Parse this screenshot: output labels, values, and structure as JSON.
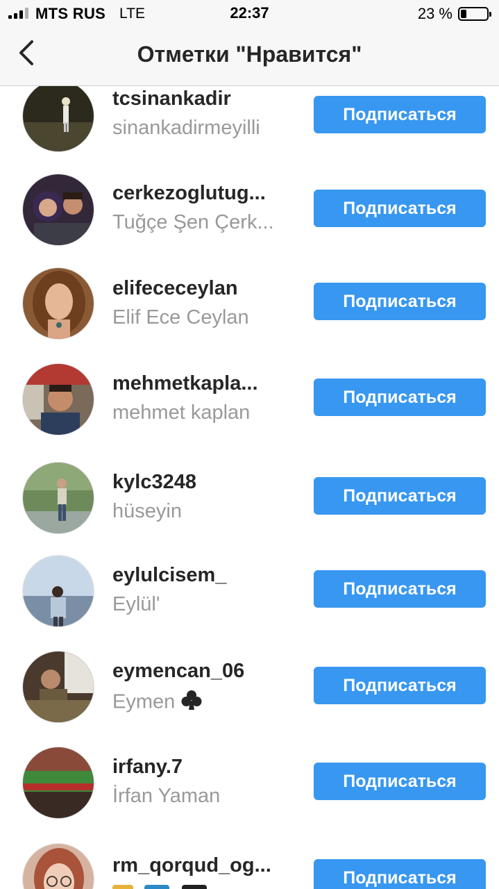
{
  "status_bar": {
    "carrier": "MTS RUS",
    "network": "LTE",
    "time": "22:37",
    "battery_percent": "23 %",
    "battery_level": 0.23
  },
  "nav": {
    "title": "Отметки \"Нравится\"",
    "back_icon": "chevron-left-icon"
  },
  "follow_label": "Подписаться",
  "users": [
    {
      "username": "tcsinankadir",
      "full_name": "sinankadirmeyilli"
    },
    {
      "username": "cerkezoglutug...",
      "full_name": "Tuğçe Şen Çerk..."
    },
    {
      "username": "elifececeylan",
      "full_name": "Elif Ece Ceylan"
    },
    {
      "username": "mehmetkapla...",
      "full_name": "mehmet kaplan"
    },
    {
      "username": "kylc3248",
      "full_name": "hüseyin"
    },
    {
      "username": "eylulcisem_",
      "full_name": "Eylül'"
    },
    {
      "username": "eymencan_06",
      "full_name": "Eymen",
      "full_name_icon": "club-suit-icon"
    },
    {
      "username": "irfany.7",
      "full_name": "İrfan Yaman"
    },
    {
      "username": "rm_qorqud_og...",
      "full_name": ""
    }
  ]
}
